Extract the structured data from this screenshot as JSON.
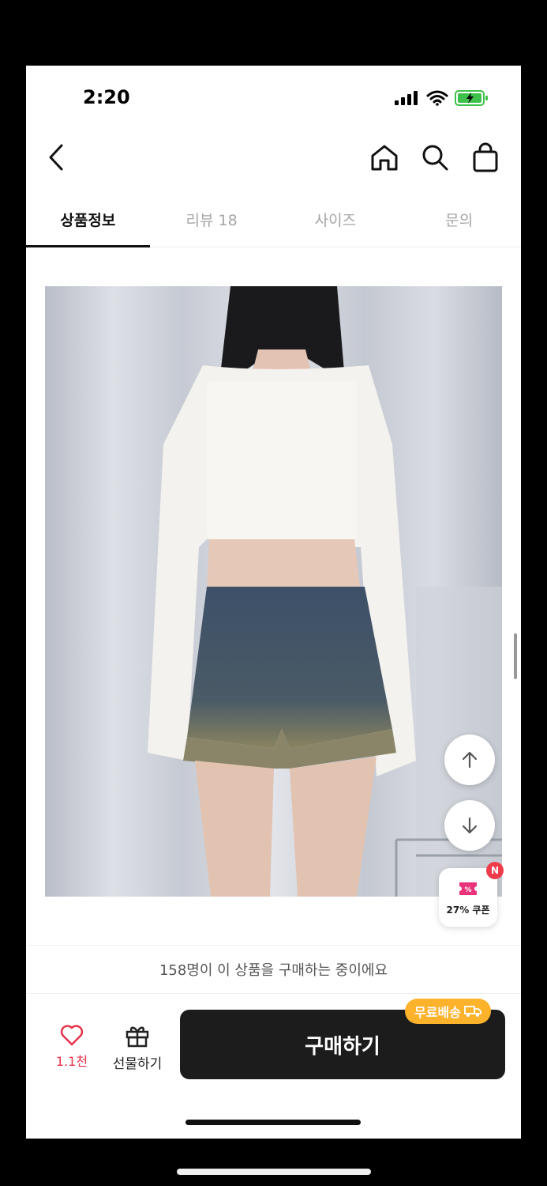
{
  "status_bar": {
    "time": "2:20"
  },
  "tabs": [
    {
      "label": "상품정보",
      "active": true
    },
    {
      "label": "리뷰 18",
      "active": false
    },
    {
      "label": "사이즈",
      "active": false
    },
    {
      "label": "문의",
      "active": false
    }
  ],
  "coupon": {
    "badge": "N",
    "label": "27% 쿠폰"
  },
  "notice": {
    "text": "158명이 이 상품을 구매하는 중이에요"
  },
  "bottom_bar": {
    "like_count": "1.1천",
    "gift_label": "선물하기",
    "buy_label": "구매하기",
    "shipping_badge": "무료배송"
  },
  "colors": {
    "accent_red": "#e8334a",
    "buy_button": "#1c1c1c",
    "shipping_badge": "#fdb22b",
    "battery_green": "#3ec14a"
  },
  "icons": [
    "back-icon",
    "home-icon",
    "search-icon",
    "shopping-bag-icon",
    "arrow-up-icon",
    "arrow-down-icon",
    "heart-icon",
    "gift-icon",
    "truck-icon",
    "coupon-ticket-icon"
  ]
}
